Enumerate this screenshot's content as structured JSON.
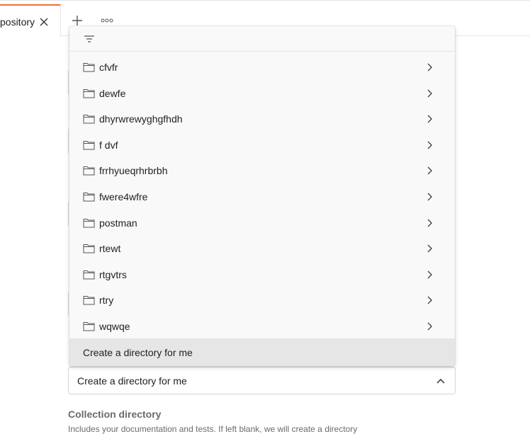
{
  "tabs": {
    "active_title": "pository"
  },
  "dropdown": {
    "items": [
      {
        "label": "cfvfr"
      },
      {
        "label": "dewfe"
      },
      {
        "label": "dhyrwrewyghgfhdh"
      },
      {
        "label": "f dvf"
      },
      {
        "label": "frrhyueqrhrbrbh"
      },
      {
        "label": "fwere4wfre"
      },
      {
        "label": "postman"
      },
      {
        "label": "rtewt"
      },
      {
        "label": "rtgvtrs"
      },
      {
        "label": "rtry"
      },
      {
        "label": "wqwqe"
      }
    ],
    "create_label": "Create a directory for me"
  },
  "select": {
    "value": "Create a directory for me"
  },
  "collection_directory": {
    "label": "Collection directory",
    "help": "Includes your documentation and tests. If left blank, we will create a directory"
  },
  "colors": {
    "accent": "#f26b3a",
    "dropdown_bg": "#f9f9f9",
    "highlight_bg": "#e6e6e6"
  }
}
